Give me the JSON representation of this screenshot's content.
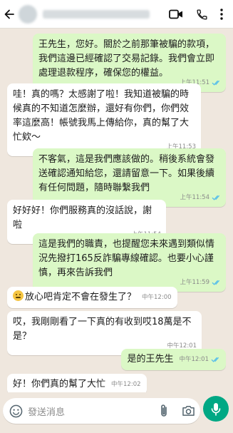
{
  "header": {
    "contact_name": "██████",
    "icons": {
      "back": "arrow-left-icon",
      "video": "video-camera-icon",
      "call": "phone-icon",
      "menu": "more-vertical-icon"
    }
  },
  "messages": [
    {
      "dir": "out",
      "text": "王先生，您好。關於之前那筆被騙的款項，我們這邊已經確認了交易記錄。我們會立即處理退款程序，確保您的權益。",
      "time": "上午11:51",
      "read": true
    },
    {
      "dir": "in",
      "text": "哇！真的嗎？太感謝了啦！我知道被騙的時候真的不知道怎麼辦，還好有你們，你們效率這麼高！帳號我馬上傳給你，真的幫了大忙欸～",
      "time": "上午11:53"
    },
    {
      "dir": "out",
      "text": "不客氣，這是我們應該做的。稍後系統會發送確認通知給您，還請留意一下。如果後續有任何問題，隨時聯繫我們",
      "time": "上午11:54",
      "read": true
    },
    {
      "dir": "in",
      "text": "好好好！你們服務真的沒話說，謝啦",
      "time": "上午11:54"
    },
    {
      "dir": "out",
      "text": "這是我們的職責，也提醒您未來遇到類似情況先撥打165反詐騙專線確認。也要小心謹慎，再來告訴我們",
      "time": "上午11:59",
      "read": true
    },
    {
      "dir": "in",
      "text": "放心吧肯定不會在發生了？",
      "time": "中午12:00",
      "emoji": "worried-face-icon"
    },
    {
      "dir": "in",
      "text": "哎，我剛剛看了一下真的有收到哎18萬是不是？",
      "time": "中午12:01"
    },
    {
      "dir": "out",
      "text": "是的王先生",
      "time": "中午12:01",
      "read": true
    },
    {
      "dir": "in",
      "text": "好！你們真的幫了大忙",
      "time": "中午12:02"
    }
  ],
  "composer": {
    "placeholder": "發送消息",
    "icons": {
      "emoji": "emoji-icon",
      "attach": "paperclip-icon",
      "camera": "camera-icon",
      "mic": "microphone-icon"
    }
  },
  "colors": {
    "accent": "#00a884",
    "outgoing_bubble": "#dbf8c6",
    "incoming_bubble": "#ffffff",
    "read_tick": "#53bdeb"
  }
}
